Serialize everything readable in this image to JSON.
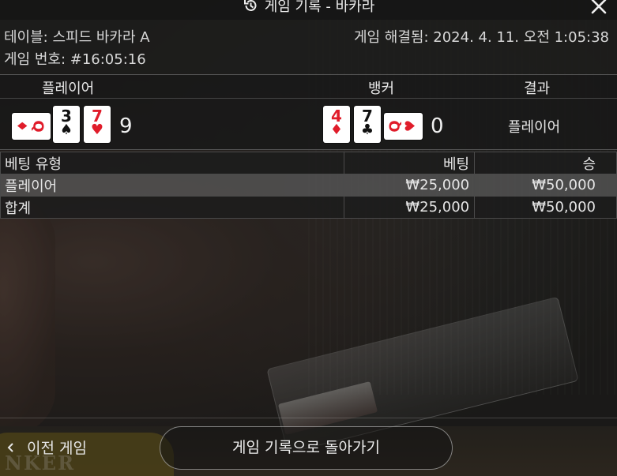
{
  "dialog": {
    "title": "게임 기록 - 바카라",
    "table_name": "테이블: 스피드 바카라 A",
    "resolved": "게임 해결됨: 2024. 4. 11. 오전 1:05:38",
    "round": "게임 번호: #16:05:16"
  },
  "results": {
    "headers": {
      "player": "플레이어",
      "banker": "뱅커",
      "result": "결과"
    },
    "player": {
      "cards": [
        {
          "rank": "Q",
          "suit": "♦",
          "color": "red",
          "orientation": "side"
        },
        {
          "rank": "3",
          "suit": "♠",
          "color": "black",
          "orientation": "upright"
        },
        {
          "rank": "7",
          "suit": "♥",
          "color": "red",
          "orientation": "upright"
        }
      ],
      "score": "9"
    },
    "banker": {
      "cards": [
        {
          "rank": "4",
          "suit": "♦",
          "color": "red",
          "orientation": "upright"
        },
        {
          "rank": "7",
          "suit": "♣",
          "color": "black",
          "orientation": "upright"
        },
        {
          "rank": "Q",
          "suit": "♥",
          "color": "red",
          "orientation": "side"
        }
      ],
      "score": "0"
    },
    "winner": "플레이어"
  },
  "bets": {
    "headers": {
      "type": "베팅 유형",
      "bet": "베팅",
      "win": "승"
    },
    "rows": [
      {
        "type": "플레이어",
        "bet": "₩25,000",
        "win": "₩50,000"
      },
      {
        "type": "합계",
        "bet": "₩25,000",
        "win": "₩50,000"
      }
    ]
  },
  "footer": {
    "prev_game": "이전 게임",
    "back_button": "게임 기록으로 돌아가기"
  },
  "background": {
    "felt_text": "NKER"
  },
  "icons": {
    "title": "history-icon",
    "close": "close-icon",
    "prev": "chevron-left-icon"
  },
  "colors": {
    "red_suit": "#e01c2a",
    "black_suit": "#111111"
  }
}
